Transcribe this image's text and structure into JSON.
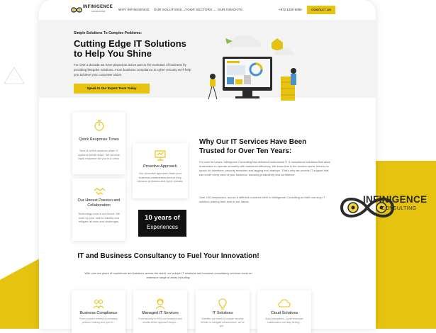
{
  "nav": {
    "logo_text": "INFINIGENCE",
    "logo_sub": "CONSULTING",
    "items": [
      "WHY INFINIGENCE",
      "OUR SOLUTIONS ⌄",
      "YOUR SECTORS ⌄",
      "OUR INSIGHTS"
    ],
    "phone": "+972 1330 6090",
    "contact": "CONTACT US"
  },
  "hero": {
    "tagline": "Simple Solutions To Complex Problems:",
    "title": "Cutting Edge IT Solutions to Help You Shine",
    "desc": "For over a decade we have played an active part in the evolution of business by providing bespoke solutions. From business compliance to cyber security we’ll help you achieve your corporate vision.",
    "button": "Speak to Our Expert Team Today"
  },
  "features": [
    {
      "title": "Quick Response Times",
      "desc": "Time is of the essence when IT systems break down. We provide rapid response for you in a crisis."
    },
    {
      "title": "Proactive Approach",
      "desc": "Our proactive approach finds your business weaknesses before they become problems and cyber threats."
    },
    {
      "title": "Our Honest Passion and Collaboration",
      "desc": "Technology runs in our blood. We work by your side to identify and mitigate all risks and challenges."
    }
  ],
  "experience": {
    "line1": "10 years of",
    "line2": "Experiences"
  },
  "why": {
    "title": "Why Our IT Services Have Been Trusted for Over Ten Years:",
    "p1": "For over ten years, Infinigence Consulting has delivered customized IT & compliance solutions that allow businesses to operate smoothly with maximum efficiency. We know that in the modern world, there’s no space for downtime, security breaches and lagging tech startups. That’s why we provide IT support that can cover every area of your business, boosting productivity and confidence.",
    "p2": "Over 100 businesses, across 6 different countries refer to Infinigence Consulting as their one-stop IT solution, placing their trust in our hands."
  },
  "section": {
    "title": "IT and Business Consultancy to Fuel Your Innovation!",
    "desc": "With over ten years of experience and solutions across the world, our unique IT solutions and business consultancy services cover an extensive range of areas including:"
  },
  "services": [
    {
      "title": "Business Compliance",
      "desc": "From contract reviews to company policies, making sure you’re..."
    },
    {
      "title": "Managed IT Services",
      "desc": "From security to 99% our proactive and results-driven approach keeps..."
    },
    {
      "title": "IT Solutions",
      "desc": "Whether you need to conquer security threats or navigate infrastructure, we’ve got..."
    },
    {
      "title": "Cloud Solutions",
      "desc": "Avoid disruptions, boost employee collaboration and stay flexing..."
    }
  ],
  "badge": {
    "title": "INFINIGENCE",
    "sub": "CONSULTING"
  },
  "colors": {
    "accent": "#e6c311",
    "dark": "#111111"
  }
}
